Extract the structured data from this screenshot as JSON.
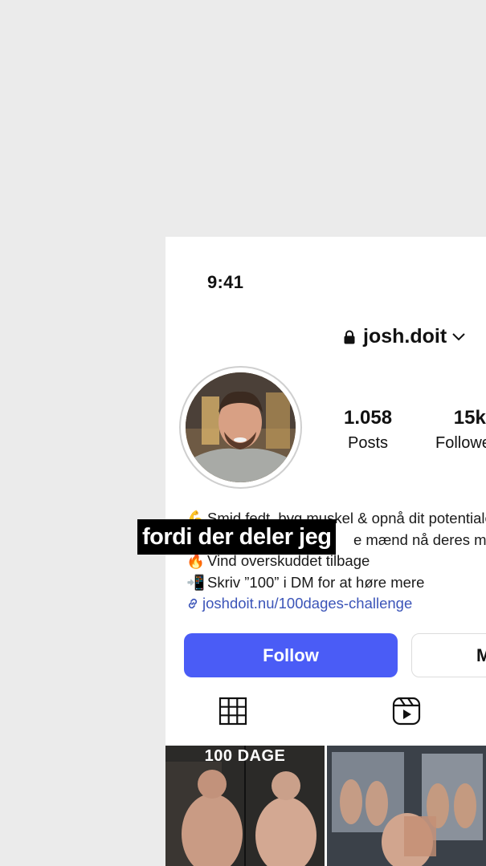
{
  "status_bar": {
    "time": "9:41"
  },
  "profile": {
    "username": "josh.doit",
    "stats": [
      {
        "value": "1.058",
        "label": "Posts"
      },
      {
        "value": "15k",
        "label": "Followers"
      }
    ],
    "bio_lines": [
      {
        "emoji": "💪",
        "text": "Smid fedt, byg muskel & opnå dit potentiale"
      },
      {
        "emoji": "",
        "text": "e mænd nå deres mål"
      },
      {
        "emoji": "🔥",
        "text": "Vind overskuddet tilbage"
      },
      {
        "emoji": "📲",
        "text": "Skriv ”100” i DM for at høre mere"
      }
    ],
    "link": "joshdoit.nu/100dages-challenge"
  },
  "actions": {
    "follow_label": "Follow",
    "message_label": "Message"
  },
  "tabs": [
    {
      "icon": "grid-icon"
    },
    {
      "icon": "reels-icon"
    }
  ],
  "posts": [
    {
      "title": "100 DAGE"
    },
    {
      "title": ""
    }
  ],
  "caption_overlay": "fordi der deler jeg",
  "colors": {
    "follow_button": "#4a5cf6",
    "link": "#3b54b8",
    "background": "#ebebeb"
  }
}
